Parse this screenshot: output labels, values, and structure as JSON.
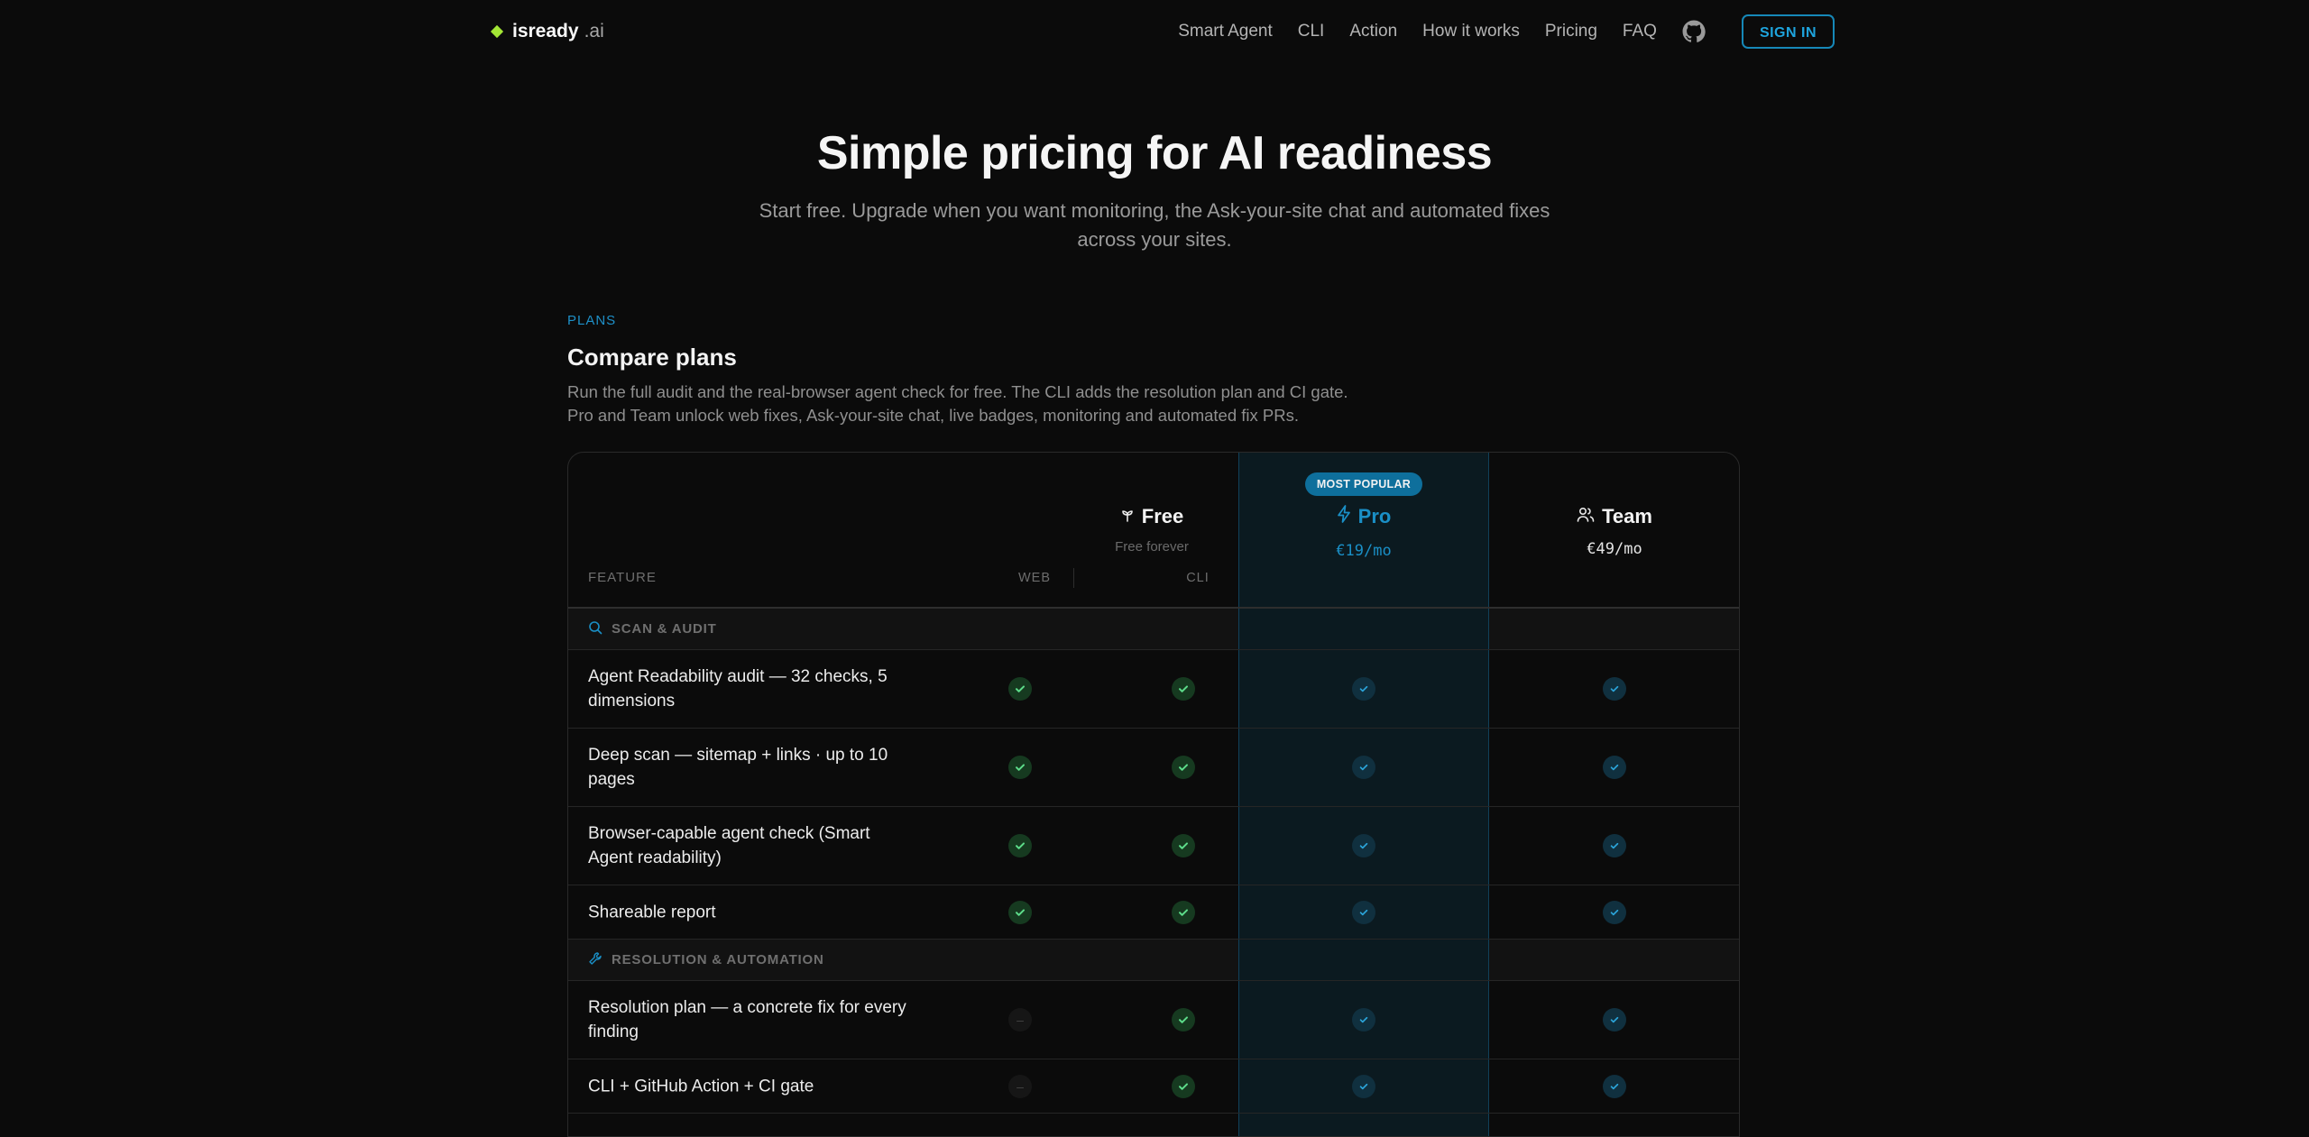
{
  "nav": {
    "logo_text": "isready",
    "logo_tld": ".ai",
    "links": [
      "Smart Agent",
      "CLI",
      "Action",
      "How it works",
      "Pricing",
      "FAQ"
    ],
    "signin_label": "SIGN IN"
  },
  "hero": {
    "title": "Simple pricing for AI readiness",
    "subtitle": "Start free. Upgrade when you want monitoring, the Ask-your-site chat and automated fixes across your sites."
  },
  "plans_section": {
    "eyebrow": "PLANS",
    "title": "Compare plans",
    "desc_line1": "Run the full audit and the real-browser agent check for free. The CLI adds the resolution plan and CI gate.",
    "desc_line2": "Pro and Team unlock web fixes, Ask-your-site chat, live badges, monitoring and automated fix PRs."
  },
  "table": {
    "feature_header": "FEATURE",
    "badge": "MOST POPULAR",
    "free": {
      "name": "Free",
      "price": "Free forever",
      "sub_web": "WEB",
      "sub_cli": "CLI"
    },
    "pro": {
      "name": "Pro",
      "price": "€19/mo"
    },
    "team": {
      "name": "Team",
      "price": "€49/mo"
    },
    "categories": [
      {
        "label": "SCAN & AUDIT",
        "rows": [
          {
            "feature": "Agent Readability audit — 32 checks, 5 dimensions",
            "web": true,
            "cli": true,
            "pro": true,
            "team": true
          },
          {
            "feature": "Deep scan — sitemap + links · up to 10 pages",
            "web": true,
            "cli": true,
            "pro": true,
            "team": true
          },
          {
            "feature": "Browser-capable agent check (Smart Agent readability)",
            "web": true,
            "cli": true,
            "pro": true,
            "team": true
          },
          {
            "feature": "Shareable report",
            "web": true,
            "cli": true,
            "pro": true,
            "team": true
          }
        ]
      },
      {
        "label": "RESOLUTION & AUTOMATION",
        "rows": [
          {
            "feature": "Resolution plan — a concrete fix for every finding",
            "web": false,
            "cli": true,
            "pro": true,
            "team": true
          },
          {
            "feature": "CLI + GitHub Action + CI gate",
            "web": false,
            "cli": true,
            "pro": true,
            "team": true
          }
        ]
      }
    ],
    "dash_glyph": "–"
  },
  "colors": {
    "accent": "#1a8fc6",
    "green": "#4ade80",
    "logo": "#a3e635"
  }
}
